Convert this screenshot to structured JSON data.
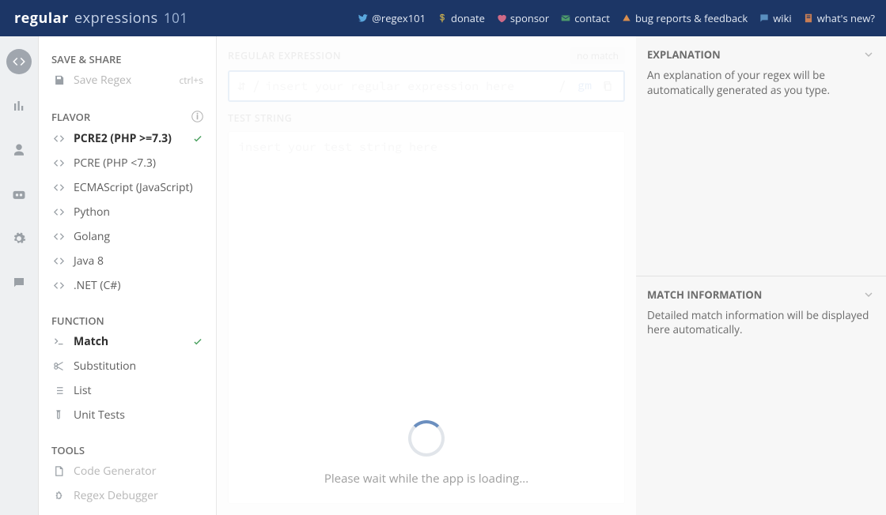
{
  "logo": {
    "part1": "regular",
    "part2": "expressions",
    "part3": "101"
  },
  "topnav": [
    {
      "label": "@regex101",
      "icon": "twitter-icon",
      "colorClass": "ic-twitter"
    },
    {
      "label": "donate",
      "icon": "dollar-icon",
      "colorClass": "ic-dollar"
    },
    {
      "label": "sponsor",
      "icon": "heart-icon",
      "colorClass": "ic-heart"
    },
    {
      "label": "contact",
      "icon": "mail-icon",
      "colorClass": "ic-mail"
    },
    {
      "label": "bug reports & feedback",
      "icon": "flag-icon",
      "colorClass": "ic-flag"
    },
    {
      "label": "wiki",
      "icon": "chat-icon",
      "colorClass": "ic-chat"
    },
    {
      "label": "what's new?",
      "icon": "doc-icon",
      "colorClass": "ic-doc"
    }
  ],
  "sections": {
    "save": "SAVE & SHARE",
    "flavor": "FLAVOR",
    "function": "FUNCTION",
    "tools": "TOOLS"
  },
  "save": {
    "save_regex": "Save Regex",
    "shortcut": "ctrl+s"
  },
  "flavors": [
    {
      "label": "PCRE2 (PHP >=7.3)",
      "selected": true
    },
    {
      "label": "PCRE (PHP <7.3)",
      "selected": false
    },
    {
      "label": "ECMAScript (JavaScript)",
      "selected": false
    },
    {
      "label": "Python",
      "selected": false
    },
    {
      "label": "Golang",
      "selected": false
    },
    {
      "label": "Java 8",
      "selected": false
    },
    {
      "label": ".NET (C#)",
      "selected": false
    }
  ],
  "functions": [
    {
      "label": "Match",
      "selected": true,
      "icon": "terminal-icon"
    },
    {
      "label": "Substitution",
      "selected": false,
      "icon": "scissors-icon"
    },
    {
      "label": "List",
      "selected": false,
      "icon": "list-icon"
    },
    {
      "label": "Unit Tests",
      "selected": false,
      "icon": "vial-icon"
    }
  ],
  "tools": [
    {
      "label": "Code Generator",
      "icon": "page-icon",
      "dim": true
    },
    {
      "label": "Regex Debugger",
      "icon": "bug-icon",
      "dim": true
    }
  ],
  "center": {
    "regex_header": "REGULAR EXPRESSION",
    "nomatch": "no match",
    "regex_placeholder": "insert your regular expression here",
    "regex_value": "",
    "delim_open": "/",
    "delim_close": "/",
    "flags": "gm",
    "test_header": "TEST STRING",
    "test_placeholder": "insert your test string here",
    "loading": "Please wait while the app is loading..."
  },
  "right": {
    "explanation_h": "EXPLANATION",
    "explanation_body": "An explanation of your regex will be automatically generated as you type.",
    "match_h": "MATCH INFORMATION",
    "match_body": "Detailed match information will be displayed here automatically."
  }
}
